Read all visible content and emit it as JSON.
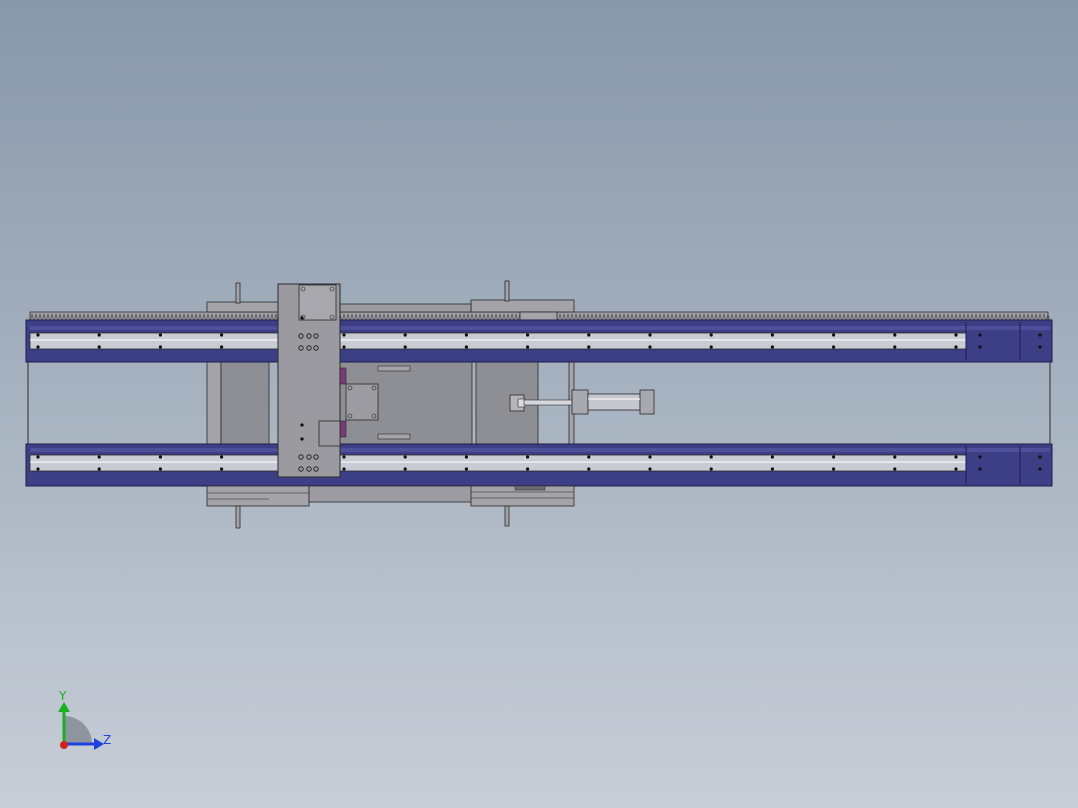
{
  "colors": {
    "background_top": "#8898aa",
    "background_bottom": "#c8ced8",
    "rail_frame": "#3c3e86",
    "rail_frame_dark": "#22245a",
    "guide_rod": "#c9ccd4",
    "plate_gray": "#8e8e95",
    "plate_light": "#a3a3a8",
    "outline": "#2a2a2a",
    "accent_purple": "#7a3a78",
    "axis_y": "#1db01d",
    "axis_z": "#2040e0",
    "axis_x": "#d02020"
  },
  "triad": {
    "y_label": "Y",
    "z_label": "Z"
  }
}
